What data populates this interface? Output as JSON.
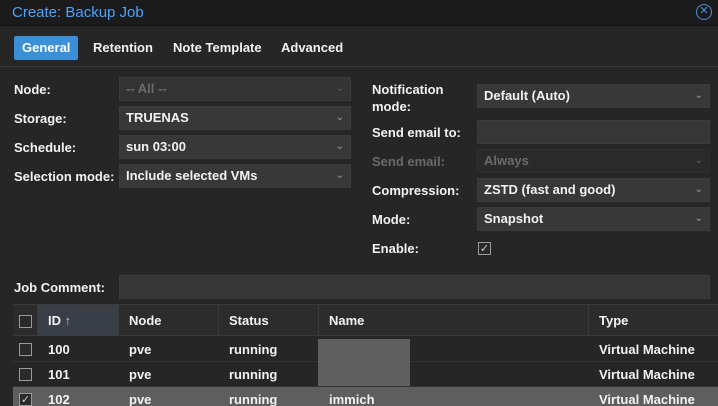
{
  "dialog": {
    "title": "Create: Backup Job",
    "close_icon": "close-circle-icon"
  },
  "tabs": [
    "General",
    "Retention",
    "Note Template",
    "Advanced"
  ],
  "left_form": {
    "node": {
      "label": "Node:",
      "value": "-- All --"
    },
    "storage": {
      "label": "Storage:",
      "value": "TRUENAS"
    },
    "schedule": {
      "label": "Schedule:",
      "value": "sun 03:00"
    },
    "selection_mode": {
      "label": "Selection mode:",
      "value": "Include selected VMs"
    }
  },
  "right_form": {
    "notification_mode": {
      "label_line1": "Notification",
      "label_line2": "mode:",
      "value": "Default (Auto)"
    },
    "send_email_to": {
      "label": "Send email to:",
      "value": ""
    },
    "send_email": {
      "label": "Send email:",
      "value": "Always"
    },
    "compression": {
      "label": "Compression:",
      "value": "ZSTD (fast and good)"
    },
    "mode": {
      "label": "Mode:",
      "value": "Snapshot"
    },
    "enable": {
      "label": "Enable:",
      "checked": true,
      "check_glyph": "✓"
    }
  },
  "job_comment": {
    "label": "Job Comment:",
    "value": ""
  },
  "grid": {
    "columns": [
      "ID",
      "Node",
      "Status",
      "Name",
      "Type"
    ],
    "sort_glyph": "↑",
    "rows": [
      {
        "id": "100",
        "node": "pve",
        "status": "running",
        "name": "",
        "type": "Virtual Machine",
        "checked": false
      },
      {
        "id": "101",
        "node": "pve",
        "status": "running",
        "name": "",
        "type": "Virtual Machine",
        "checked": false
      },
      {
        "id": "102",
        "node": "pve",
        "status": "running",
        "name": "immich",
        "type": "Virtual Machine",
        "checked": true
      }
    ]
  },
  "colors": {
    "accent": "#3a8fd6",
    "title": "#4aa3ff",
    "background": "#262626"
  }
}
